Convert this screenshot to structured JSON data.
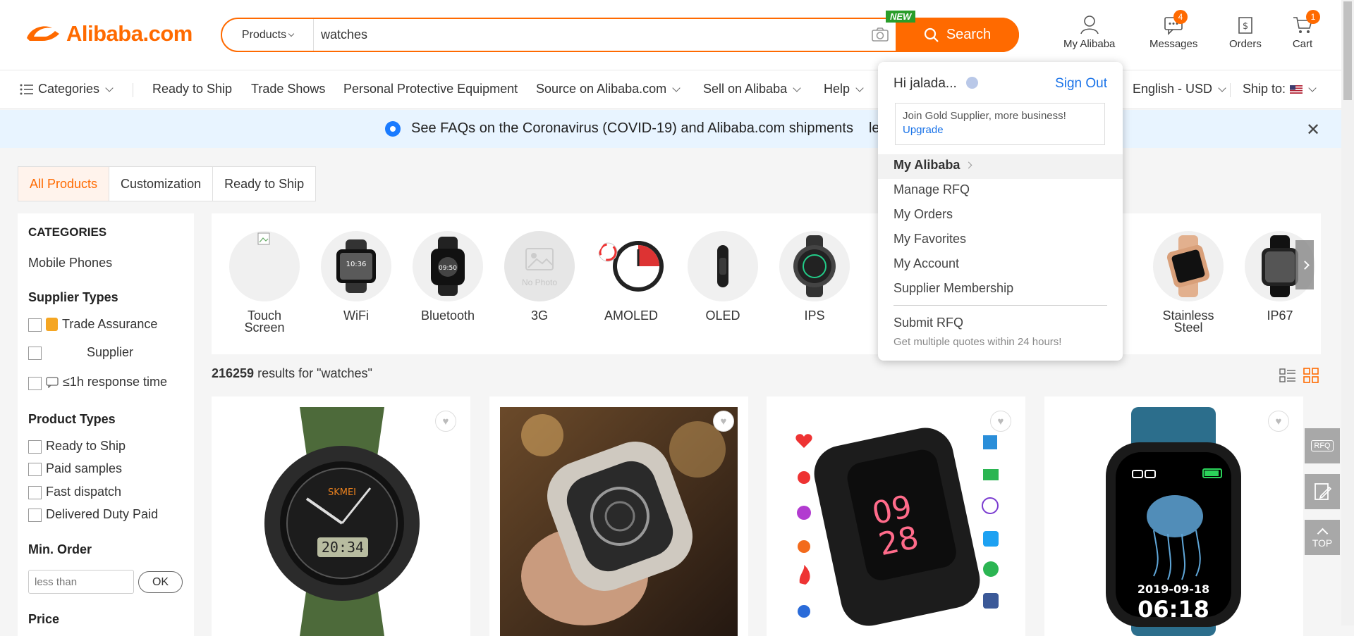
{
  "header": {
    "logo": "Alibaba.com",
    "search_category": "Products",
    "search_value": "watches",
    "new_badge": "NEW",
    "search_button": "Search",
    "my_alibaba": "My Alibaba",
    "messages": "Messages",
    "messages_count": "4",
    "orders": "Orders",
    "cart": "Cart",
    "cart_count": "1"
  },
  "nav": {
    "categories": "Categories",
    "ready_to_ship": "Ready to Ship",
    "trade_shows": "Trade Shows",
    "ppe": "Personal Protective Equipment",
    "source": "Source on Alibaba.com",
    "sell": "Sell on Alibaba",
    "help": "Help",
    "language": "English - USD",
    "ship_to": "Ship to:"
  },
  "banner": {
    "text": "See FAQs on the Coronavirus (COVID-19) and Alibaba.com shipments",
    "partial": "le"
  },
  "tabs": [
    "All Products",
    "Customization",
    "Ready to Ship"
  ],
  "sidebar": {
    "categories_title": "CATEGORIES",
    "category_item": "Mobile Phones",
    "supplier_types_title": "Supplier Types",
    "trade_assurance": "Trade Assurance",
    "supplier": "Supplier",
    "response_time": "≤1h response time",
    "product_types_title": "Product Types",
    "product_types": [
      "Ready to Ship",
      "Paid samples",
      "Fast dispatch",
      "Delivered Duty Paid"
    ],
    "min_order_title": "Min. Order",
    "min_order_placeholder": "less than",
    "ok": "OK",
    "price_title": "Price"
  },
  "categories": [
    {
      "label": "Touch Screen"
    },
    {
      "label": "WiFi"
    },
    {
      "label": "Bluetooth"
    },
    {
      "label": "3G",
      "placeholder": "No Photo"
    },
    {
      "label": "AMOLED"
    },
    {
      "label": "OLED"
    },
    {
      "label": "IPS"
    },
    {
      "label": "Stainless Steel"
    },
    {
      "label": "IP67"
    }
  ],
  "results": {
    "count": "216259",
    "text": " results for \"watches\""
  },
  "products": [
    {
      "alt": "sport watch"
    },
    {
      "alt": "skeleton watch"
    },
    {
      "alt": "smart watch"
    },
    {
      "alt": "smart watch jellyfish",
      "date": "2019-09-18",
      "time": "06:18"
    }
  ],
  "dropdown": {
    "greeting": "Hi jalada...",
    "sign_out": "Sign Out",
    "gold_text": "Join Gold Supplier, more business!",
    "upgrade": "Upgrade",
    "my_alibaba": "My Alibaba",
    "items": [
      "Manage RFQ",
      "My Orders",
      "My Favorites",
      "My Account",
      "Supplier Membership"
    ],
    "submit_rfq": "Submit RFQ",
    "submit_sub": "Get multiple quotes within 24 hours!"
  },
  "side_tools": {
    "rfq": "RFQ",
    "top": "TOP"
  },
  "colors": {
    "accent": "#ff6a00",
    "link": "#1a73e8",
    "banner_bg": "#e8f4ff"
  }
}
